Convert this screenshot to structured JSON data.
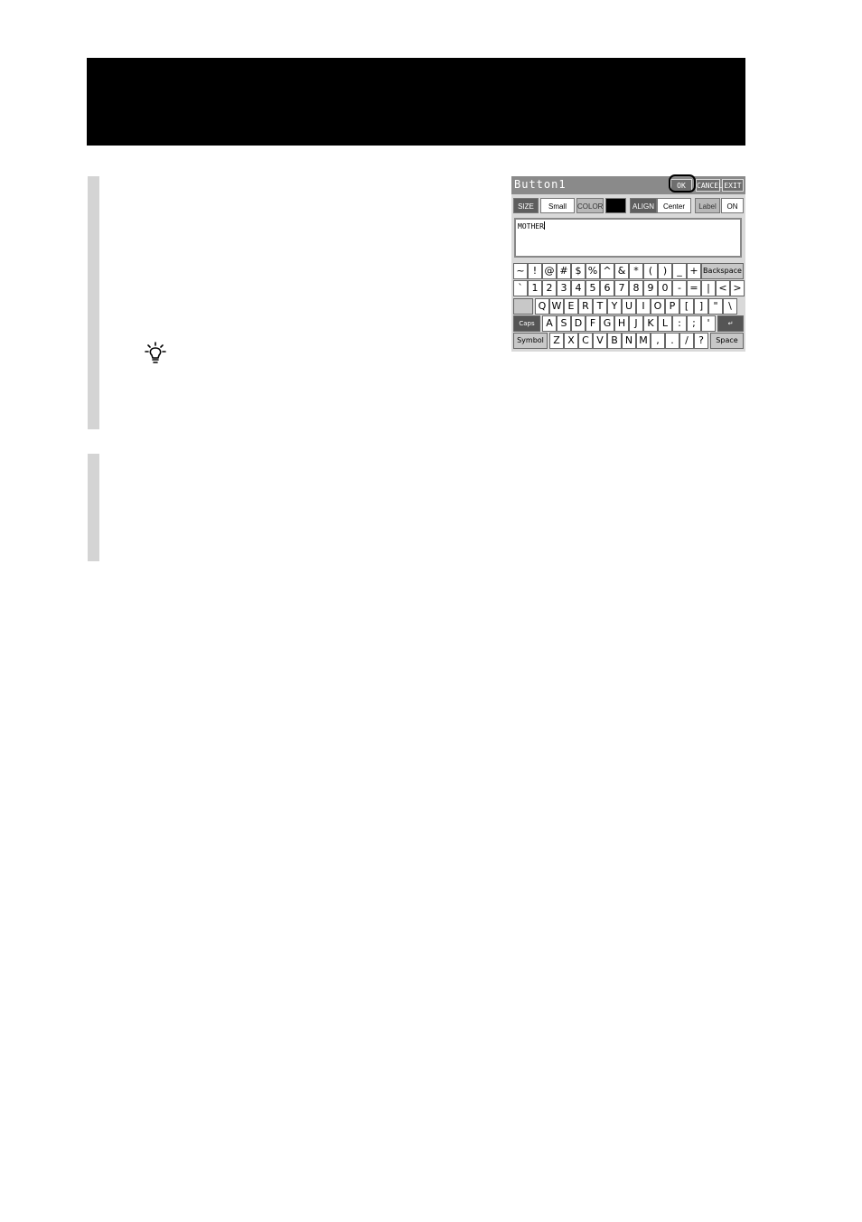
{
  "screen": {
    "title": "Button1",
    "buttons": {
      "ok": "OK",
      "cancel": "CANCEL",
      "exit": "EXIT"
    },
    "options": {
      "size_label": "SIZE",
      "size_value": "Small",
      "color_label": "COLOR",
      "color_value": "#000000",
      "align_label": "ALIGN",
      "align_value": "Center",
      "label_label": "Label",
      "label_value": "ON"
    },
    "text_value": "MOTHER",
    "keyboard": {
      "row1": [
        "~",
        "!",
        "@",
        "#",
        "$",
        "%",
        "^",
        "&",
        "*",
        "(",
        ")",
        "_",
        "+"
      ],
      "backspace": "Backspace",
      "row2": [
        "`",
        "1",
        "2",
        "3",
        "4",
        "5",
        "6",
        "7",
        "8",
        "9",
        "0",
        "-",
        "=",
        "|",
        "<",
        ">"
      ],
      "row3": [
        "Q",
        "W",
        "E",
        "R",
        "T",
        "Y",
        "U",
        "I",
        "O",
        "P",
        "[",
        "]",
        "\"",
        "\\"
      ],
      "capslock": "Caps Lock",
      "row4": [
        "A",
        "S",
        "D",
        "F",
        "G",
        "H",
        "J",
        "K",
        "L",
        ":",
        ";",
        "'"
      ],
      "enter": "↵",
      "symbol": "Symbol",
      "row5": [
        "Z",
        "X",
        "C",
        "V",
        "B",
        "N",
        "M",
        ",",
        ".",
        "/",
        "?"
      ],
      "space": "Space"
    }
  }
}
